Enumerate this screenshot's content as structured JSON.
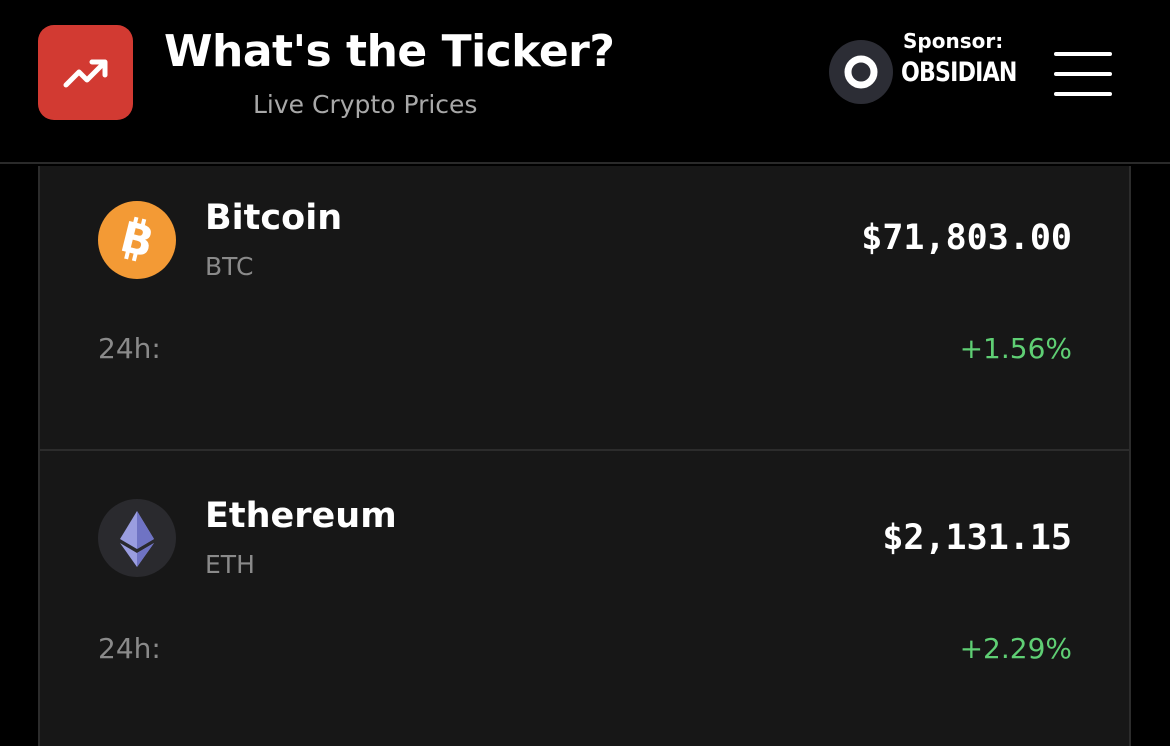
{
  "header": {
    "title": "What's the Ticker?",
    "subtitle": "Live Crypto Prices",
    "logo_icon": "trending-up-icon",
    "logo_color": "#d23a32",
    "sponsor_label": "Sponsor:",
    "sponsor_name": "OBSIDIAN",
    "sponsor_icon": "obsidian-ring-icon",
    "menu_icon": "hamburger-menu-icon"
  },
  "coins": [
    {
      "name": "Bitcoin",
      "symbol": "BTC",
      "price": "$71,803.00",
      "change_label": "24h:",
      "change": "+1.56%",
      "icon": "bitcoin-icon",
      "icon_color": "#f39a35"
    },
    {
      "name": "Ethereum",
      "symbol": "ETH",
      "price": "$2,131.15",
      "change_label": "24h:",
      "change": "+2.29%",
      "icon": "ethereum-icon",
      "icon_color": "#8c8fd6"
    }
  ],
  "colors": {
    "positive_change": "#5fcf74",
    "card_background": "#171717",
    "muted_text": "#8a8a8a"
  }
}
